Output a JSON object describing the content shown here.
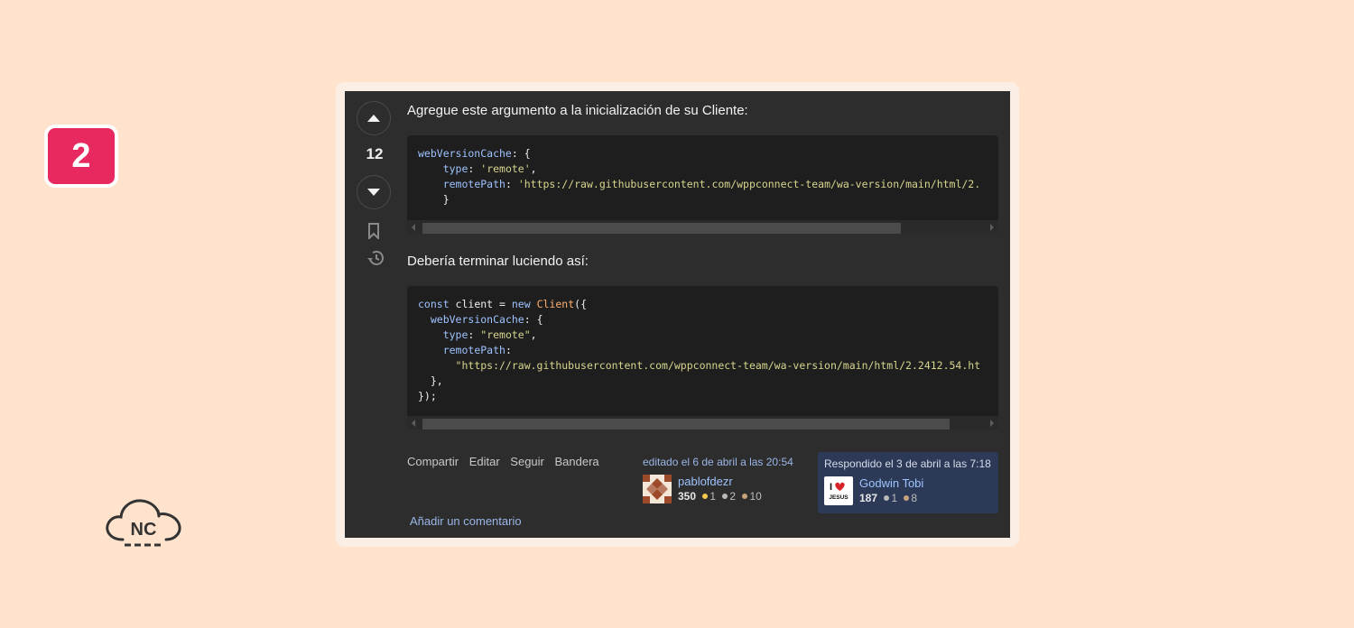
{
  "badge": {
    "number": "2"
  },
  "logo": {
    "text": "NC"
  },
  "vote": {
    "count": "12"
  },
  "post": {
    "intro": "Agregue este argumento a la inicialización de su Cliente:",
    "outro": "Debería terminar luciendo así:",
    "code1_lines": [
      {
        "parts": [
          [
            "k",
            "webVersionCache"
          ],
          [
            "t",
            ": {"
          ]
        ]
      },
      {
        "parts": [
          [
            "t",
            "    "
          ],
          [
            "k",
            "type"
          ],
          [
            "t",
            ": "
          ],
          [
            "s",
            "'remote'"
          ],
          [
            "t",
            ","
          ]
        ]
      },
      {
        "parts": [
          [
            "t",
            "    "
          ],
          [
            "k",
            "remotePath"
          ],
          [
            "t",
            ": "
          ],
          [
            "s",
            "'https://raw.githubusercontent.com/wppconnect-team/wa-version/main/html/2."
          ]
        ]
      },
      {
        "parts": [
          [
            "t",
            "    }"
          ]
        ]
      }
    ],
    "code2_lines": [
      {
        "parts": [
          [
            "k",
            "const"
          ],
          [
            "t",
            " client = "
          ],
          [
            "k",
            "new"
          ],
          [
            "t",
            " "
          ],
          [
            "c",
            "Client"
          ],
          [
            "t",
            "({"
          ]
        ]
      },
      {
        "parts": [
          [
            "t",
            "  "
          ],
          [
            "k",
            "webVersionCache"
          ],
          [
            "t",
            ": {"
          ]
        ]
      },
      {
        "parts": [
          [
            "t",
            "    "
          ],
          [
            "k",
            "type"
          ],
          [
            "t",
            ": "
          ],
          [
            "s",
            "\"remote\""
          ],
          [
            "t",
            ","
          ]
        ]
      },
      {
        "parts": [
          [
            "t",
            "    "
          ],
          [
            "k",
            "remotePath"
          ],
          [
            "t",
            ":"
          ]
        ]
      },
      {
        "parts": [
          [
            "t",
            "      "
          ],
          [
            "s",
            "\"https://raw.githubusercontent.com/wppconnect-team/wa-version/main/html/2.2412.54.ht"
          ]
        ]
      },
      {
        "parts": [
          [
            "t",
            "  },"
          ]
        ]
      },
      {
        "parts": [
          [
            "t",
            "});"
          ]
        ]
      }
    ]
  },
  "menu": {
    "share": "Compartir",
    "edit": "Editar",
    "follow": "Seguir",
    "flag": "Bandera"
  },
  "editor": {
    "time": "editado el 6 de abril a las 20:54",
    "name": "pablofdezr",
    "rep": "350",
    "gold": "1",
    "silver": "2",
    "bronze": "10"
  },
  "author": {
    "time": "Respondido el 3 de abril a las 7:18",
    "name": "Godwin Tobi",
    "rep": "187",
    "silver": "1",
    "bronze": "8",
    "avatar_text": "JESUS"
  },
  "add_comment": "Añadir un comentario",
  "colors": {
    "badge": "#e8295f",
    "background": "#ffe3cc",
    "panel": "#2d2d2d",
    "author_card": "#2c3a57"
  }
}
